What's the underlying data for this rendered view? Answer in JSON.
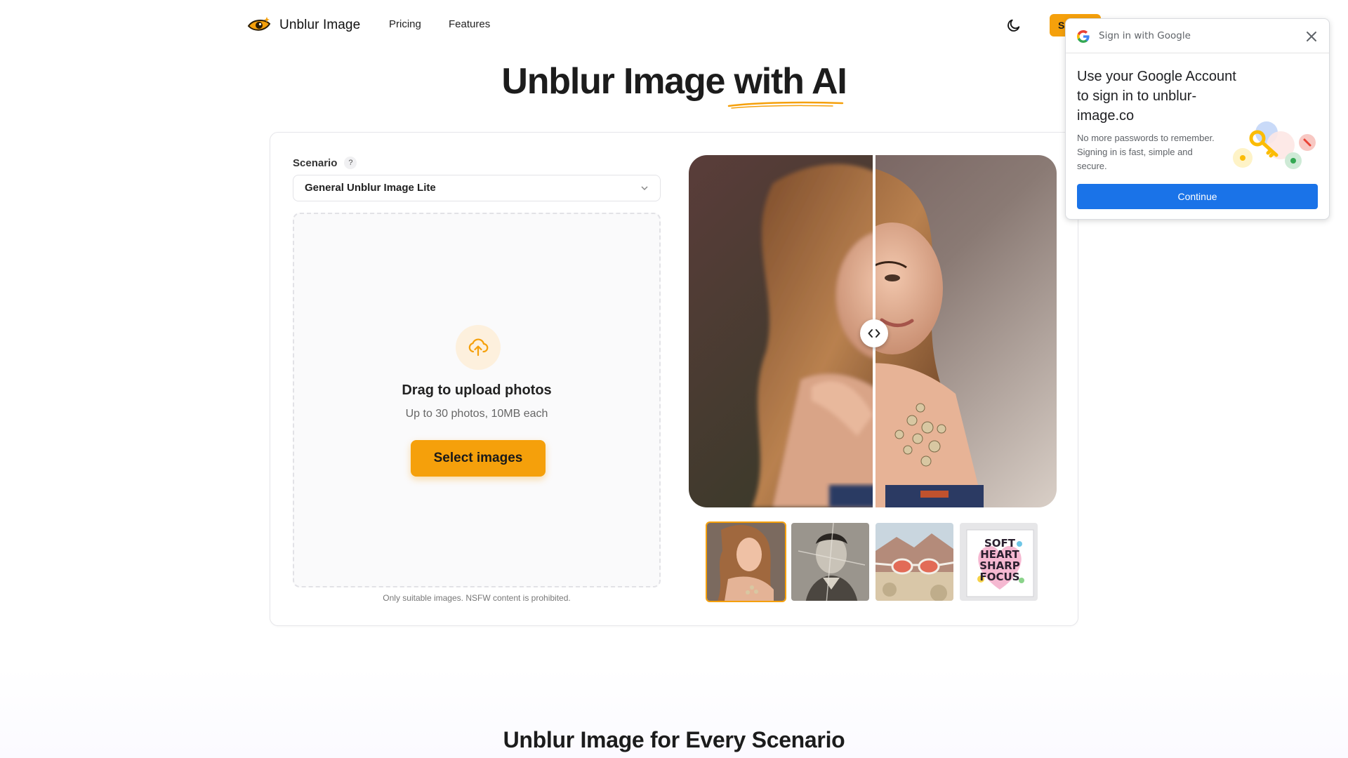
{
  "nav": {
    "brand": "Unblur Image",
    "links": [
      {
        "label": "Pricing"
      },
      {
        "label": "Features"
      }
    ],
    "signin_label": "Sign in"
  },
  "hero": {
    "title_main": "Unblur Image ",
    "title_accent": "with AI"
  },
  "tool": {
    "scenario_label": "Scenario",
    "scenario_help": "?",
    "scenario_value": "General Unblur Image Lite",
    "drop_title": "Drag to upload photos",
    "drop_subtitle": "Up to 30 photos, 10MB each",
    "select_button": "Select images",
    "nsfw_note": "Only suitable images. NSFW content is prohibited.",
    "thumbnails": [
      {
        "name": "portrait-woman",
        "active": true
      },
      {
        "name": "old-photo-boy",
        "active": false
      },
      {
        "name": "sunglasses-desert",
        "active": false
      },
      {
        "name": "soft-heart-sharp-focus",
        "active": false
      }
    ],
    "thumb_text": [
      "SOFT",
      "HEART",
      "SHARP",
      "FOCUS"
    ]
  },
  "section2": {
    "title": "Unblur Image for Every Scenario"
  },
  "google_onetap": {
    "header": "Sign in with Google",
    "title": "Use your Google Account to sign in to unblur-image.co",
    "description": "No more passwords to remember. Signing in is fast, simple and secure.",
    "continue_label": "Continue"
  },
  "colors": {
    "accent": "#f5a00b",
    "google_blue": "#1a73e8"
  }
}
